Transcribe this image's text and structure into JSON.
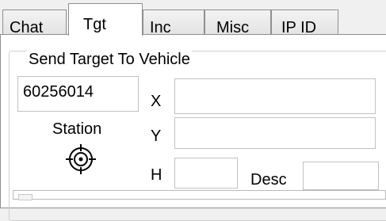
{
  "tabs": [
    {
      "label": "Chat",
      "active": false
    },
    {
      "label": "Tgt",
      "active": true
    },
    {
      "label": "Inc",
      "active": false
    },
    {
      "label": "Misc",
      "active": false
    },
    {
      "label": "IP ID",
      "active": false
    }
  ],
  "group": {
    "title": "Send Target To Vehicle",
    "id_value": "60256014",
    "station_label": "Station",
    "station_icon": "crosshair-icon",
    "x_label": "X",
    "x_value": "",
    "y_label": "Y",
    "y_value": "",
    "h_label": "H",
    "h_value": "",
    "desc_label": "Desc",
    "desc_value": ""
  },
  "colors": {
    "window_background": "#f0f0f0",
    "panel_background": "#ffffff",
    "border": "#8e8f8f"
  }
}
